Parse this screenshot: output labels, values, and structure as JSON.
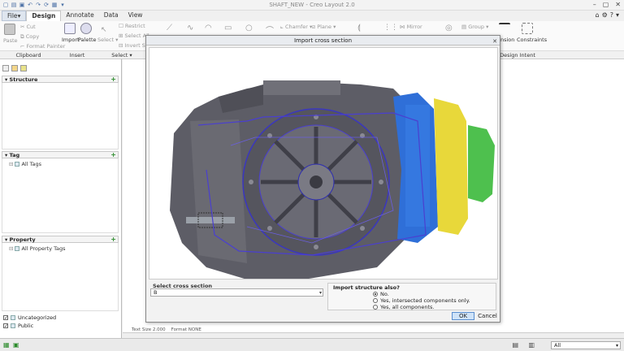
{
  "window": {
    "title": "SHAFT_NEW - Creo Layout 2.0"
  },
  "tabs": [
    {
      "label": "File"
    },
    {
      "label": "Design"
    },
    {
      "label": "Annotate"
    },
    {
      "label": "Data"
    },
    {
      "label": "View"
    }
  ],
  "ribbon": {
    "clipboard": {
      "paste": "Paste",
      "cut": "Cut",
      "copy": "Copy",
      "format_painter": "Format Painter",
      "label": "Clipboard"
    },
    "insert": {
      "import": "Import",
      "palette": "Palette",
      "label": "Insert"
    },
    "select": {
      "select": "Select",
      "restrict": "Restrict",
      "select_all": "Select All",
      "invert": "Invert Sele",
      "label": "Select"
    },
    "sketch": {
      "chamfer": "Chamfer",
      "plane": "Plane",
      "mirror": "Mirror",
      "group": "Group"
    },
    "right": {
      "dimension": "ension",
      "constraints": "Constraints",
      "design_intent": "Design Intent"
    }
  },
  "left_panel": {
    "structure": {
      "title": "Structure"
    },
    "tag": {
      "title": "Tag",
      "item": "All Tags"
    },
    "property": {
      "title": "Property",
      "item": "All Property Tags"
    },
    "filters": [
      {
        "label": "Uncategorized",
        "checked": true
      },
      {
        "label": "Public",
        "checked": true
      }
    ]
  },
  "canvas_status": {
    "text_size": "Text Size 2.000",
    "format": "Format NONE"
  },
  "dialog": {
    "title": "Import cross section",
    "select_label": "Select cross section",
    "select_value": "B",
    "import_label": "Import structure also?",
    "options": [
      {
        "label": "No.",
        "selected": true
      },
      {
        "label": "Yes, intersected components only.",
        "selected": false
      },
      {
        "label": "Yes, all components.",
        "selected": false
      }
    ],
    "ok": "OK",
    "cancel": "Cancel"
  },
  "statusbar": {
    "filter_value": "All"
  },
  "colors": {
    "accent": "#5b8fd0",
    "part_gray": "#5c5c66",
    "part_blue": "#2f6fd8",
    "part_yellow": "#e8d83a",
    "part_green": "#4ec04e",
    "section_purple": "#4a3fd0"
  }
}
